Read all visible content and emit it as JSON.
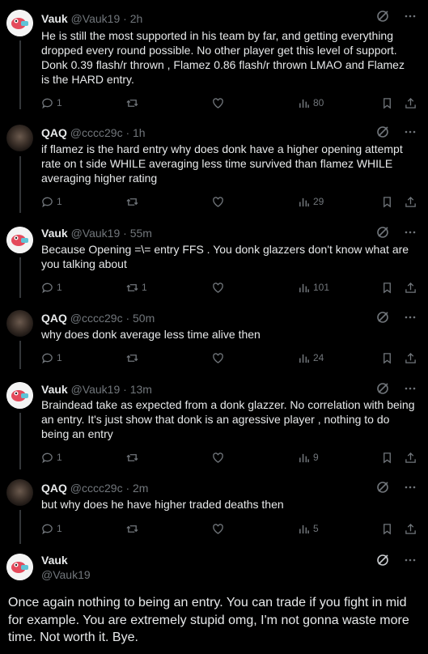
{
  "colors": {
    "background": "#000000",
    "text": "#e7e9ea",
    "muted": "#71767b",
    "divider": "#2f3336"
  },
  "tweets": [
    {
      "name": "Vauk",
      "handle": "@Vauk19",
      "time": "· 2h",
      "text": "He is still the most supported in his team by far, and getting everything dropped every round possible. No other player get this level of support. Donk 0.39 flash/r thrown , Flamez 0.86 flash/r thrown LMAO and Flamez is the HARD entry.",
      "replies": "1",
      "retweets": "",
      "views": "80"
    },
    {
      "name": "QAQ",
      "handle": "@cccc29c",
      "time": "· 1h",
      "text": "if flamez is the hard entry why does donk have a higher opening attempt rate on t side WHILE averaging less time survived than flamez WHILE averaging higher rating",
      "replies": "1",
      "retweets": "",
      "views": "29"
    },
    {
      "name": "Vauk",
      "handle": "@Vauk19",
      "time": "· 55m",
      "text": "Because Opening =\\= entry FFS . You donk glazzers don't know what are you talking about",
      "replies": "1",
      "retweets": "1",
      "views": "101"
    },
    {
      "name": "QAQ",
      "handle": "@cccc29c",
      "time": "· 50m",
      "text": "why does donk average less time alive then",
      "replies": "1",
      "retweets": "",
      "views": "24"
    },
    {
      "name": "Vauk",
      "handle": "@Vauk19",
      "time": "· 13m",
      "text": "Braindead take as expected from a donk glazzer. No correlation with being an entry.  It's just show that donk is an agressive player , nothing to do being an entry",
      "replies": "1",
      "retweets": "",
      "views": "9"
    },
    {
      "name": "QAQ",
      "handle": "@cccc29c",
      "time": "· 2m",
      "text": "but why does he have higher traded deaths then",
      "replies": "1",
      "retweets": "",
      "views": "5"
    }
  ],
  "final": {
    "name": "Vauk",
    "handle": "@Vauk19",
    "text": "Once again nothing to being an entry. You can trade if you fight in mid for example. You are extremely stupid omg,  I'm not gonna waste more time. Not worth it. Bye."
  },
  "icons": [
    "grok-icon",
    "more-icon",
    "reply-icon",
    "retweet-icon",
    "like-icon",
    "views-icon",
    "bookmark-icon",
    "share-icon"
  ]
}
